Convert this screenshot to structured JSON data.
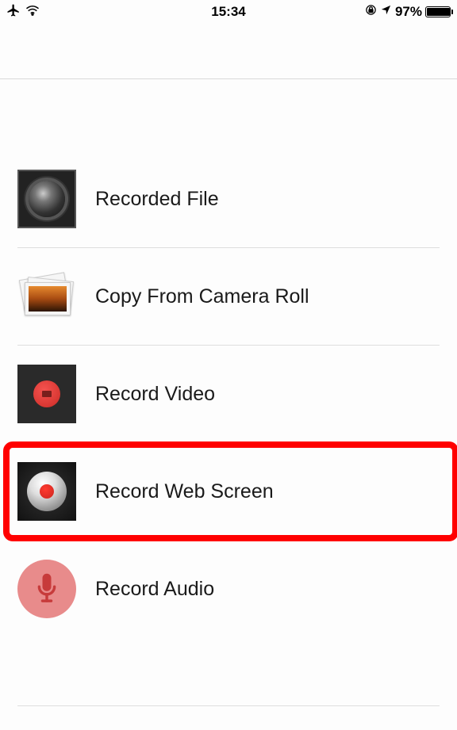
{
  "status_bar": {
    "time": "15:34",
    "battery_percent": "97%"
  },
  "menu": {
    "items": [
      {
        "label": "Recorded File"
      },
      {
        "label": "Copy From Camera Roll"
      },
      {
        "label": "Record Video"
      },
      {
        "label": "Record Web Screen"
      },
      {
        "label": "Record Audio"
      }
    ]
  }
}
